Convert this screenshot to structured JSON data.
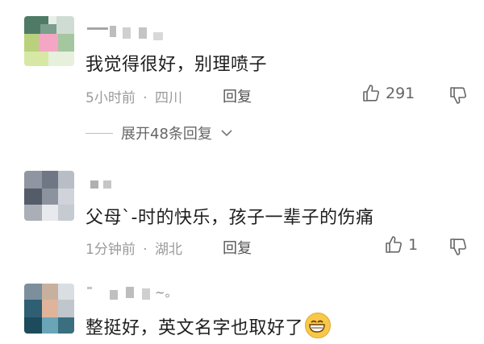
{
  "comments": [
    {
      "text": "我觉得很好，别理喷子",
      "time": "5小时前",
      "sep": "·",
      "location": "四川",
      "reply": "回复",
      "likes": "291",
      "expand": "展开48条回复"
    },
    {
      "text": "父母`-时的快乐，孩子一辈子的伤痛",
      "time": "1分钟前",
      "sep": "·",
      "location": "湖北",
      "reply": "回复",
      "likes": "1"
    },
    {
      "text": "整挺好，英文名字也取好了",
      "username_suffix": "~。"
    }
  ],
  "icons": {
    "like": "thumbs-up-icon",
    "dislike": "thumbs-down-icon",
    "expand": "chevron-down-icon",
    "emoji": "grinning-face-emoji"
  },
  "colors": {
    "text": "#1e1e1e",
    "meta": "#9a9a9a"
  }
}
